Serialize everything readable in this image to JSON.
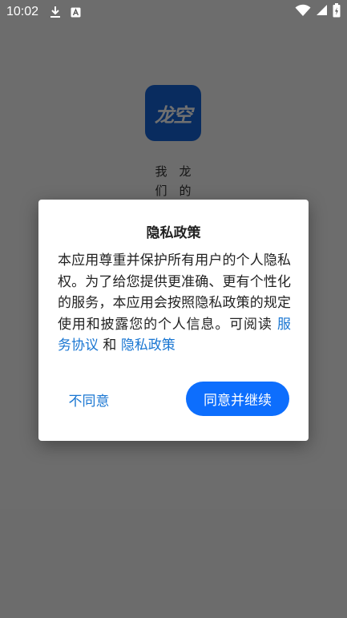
{
  "status_bar": {
    "time": "10:02",
    "icons": [
      "download-icon",
      "a-notification-icon",
      "wifi-icon",
      "signal-icon",
      "battery-icon"
    ]
  },
  "splash": {
    "logo_text": "龙空",
    "slogan_col_a": [
      "我",
      "们"
    ],
    "slogan_col_b": [
      "龙",
      "的"
    ]
  },
  "dialog": {
    "title": "隐私政策",
    "body_text": "本应用尊重并保护所有用户的个人隐私权。为了给您提供更准确、更有个性化的服务，本应用会按照隐私政策的规定使用和披露您的个人信息。可阅读 ",
    "link_service": "服务协议",
    "conjunction": " 和 ",
    "link_privacy": "隐私政策",
    "disagree_label": "不同意",
    "agree_label": "同意并继续"
  },
  "colors": {
    "accent": "#0d6efd",
    "link": "#1976d2",
    "logo_bg": "#1565d8"
  }
}
